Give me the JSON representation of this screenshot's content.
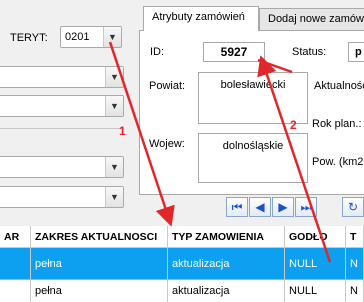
{
  "left": {
    "teryt_label": "TERYT:",
    "teryt_value": "0201"
  },
  "tabs": [
    {
      "label": "Atrybuty zamówień"
    },
    {
      "label": "Dodaj nowe zamów"
    }
  ],
  "form": {
    "id_label": "ID:",
    "id_value": "5927",
    "status_label": "Status:",
    "status_value": "p",
    "powiat_label": "Powiat:",
    "powiat_value": "bolesławiecki",
    "aktualnosc_label": "Aktualności",
    "rok_label": "Rok plan.:",
    "wojew_label": "Wojew:",
    "wojew_value": "dolnośląskie",
    "pow_label": "Pow. (km2"
  },
  "nav": [
    "first-icon",
    "prev-icon",
    "next-icon",
    "last-icon",
    "refresh-icon"
  ],
  "grid": {
    "headers": [
      "AR",
      "ZAKRES AKTUALNOSCI",
      "TYP ZAMOWIENIA",
      "GODŁO",
      "T"
    ],
    "rows": [
      [
        "",
        "pełna",
        "aktualizacja",
        "NULL",
        "N"
      ],
      [
        "",
        "pełna",
        "aktualizacja",
        "NULL",
        "N"
      ]
    ]
  },
  "annotations": {
    "arrow1_number": "1",
    "arrow2_number": "2",
    "color": "#e0282a"
  }
}
